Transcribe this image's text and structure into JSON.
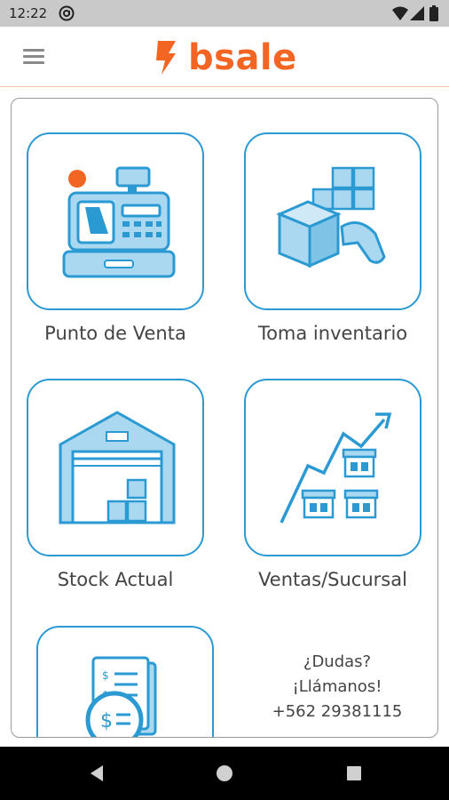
{
  "status_bar": {
    "time": "12:22",
    "icons": [
      "at-icon",
      "wifi-icon",
      "signal-icon",
      "battery-icon"
    ]
  },
  "app_bar": {
    "menu_icon": "hamburger-menu-icon",
    "logo_text": "bsale",
    "brand_color": "#f26522"
  },
  "tiles": [
    {
      "label": "Punto de Venta",
      "icon": "cash-register-icon"
    },
    {
      "label": "Toma inventario",
      "icon": "inventory-scanner-icon"
    },
    {
      "label": "Stock Actual",
      "icon": "warehouse-icon"
    },
    {
      "label": "Ventas/Sucursal",
      "icon": "sales-by-branch-icon"
    },
    {
      "label": "",
      "icon": "invoice-payment-icon"
    }
  ],
  "contact": {
    "line1": "¿Dudas?",
    "line2": "¡Llámanos!",
    "phone": "+562 29381115"
  },
  "colors": {
    "accent_blue": "#2b9ad3",
    "light_blue": "#a9d8f0",
    "brand_orange": "#f26522"
  },
  "nav_bar": {
    "icons": [
      "back-icon",
      "home-icon",
      "recents-icon"
    ]
  }
}
